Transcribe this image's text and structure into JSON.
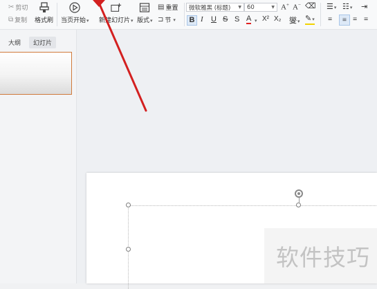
{
  "ribbon": {
    "cut_label": "剪切",
    "copy_label": "复制",
    "format_painter_label": "格式刷",
    "from_start_label": "当页开始",
    "new_slide_label": "新建幻灯片",
    "layout_label": "版式",
    "reset_label": "重置",
    "section_label": "节",
    "font_name": "微软雅黑 (标题)",
    "font_size": "60",
    "bold": "B",
    "italic": "I",
    "underline": "U",
    "strike": "S",
    "font_color": "A",
    "superscript": "X²",
    "subscript": "X₂"
  },
  "left_panel": {
    "tabs": [
      {
        "label": "大纲",
        "active": false
      },
      {
        "label": "幻灯片",
        "active": true
      }
    ]
  },
  "watermark": "软件技巧",
  "colors": {
    "annotation_arrow": "#d32020",
    "thumb_border": "#d07a3a",
    "highlight_yellow": "#f2d200",
    "font_color_red": "#e02020"
  }
}
